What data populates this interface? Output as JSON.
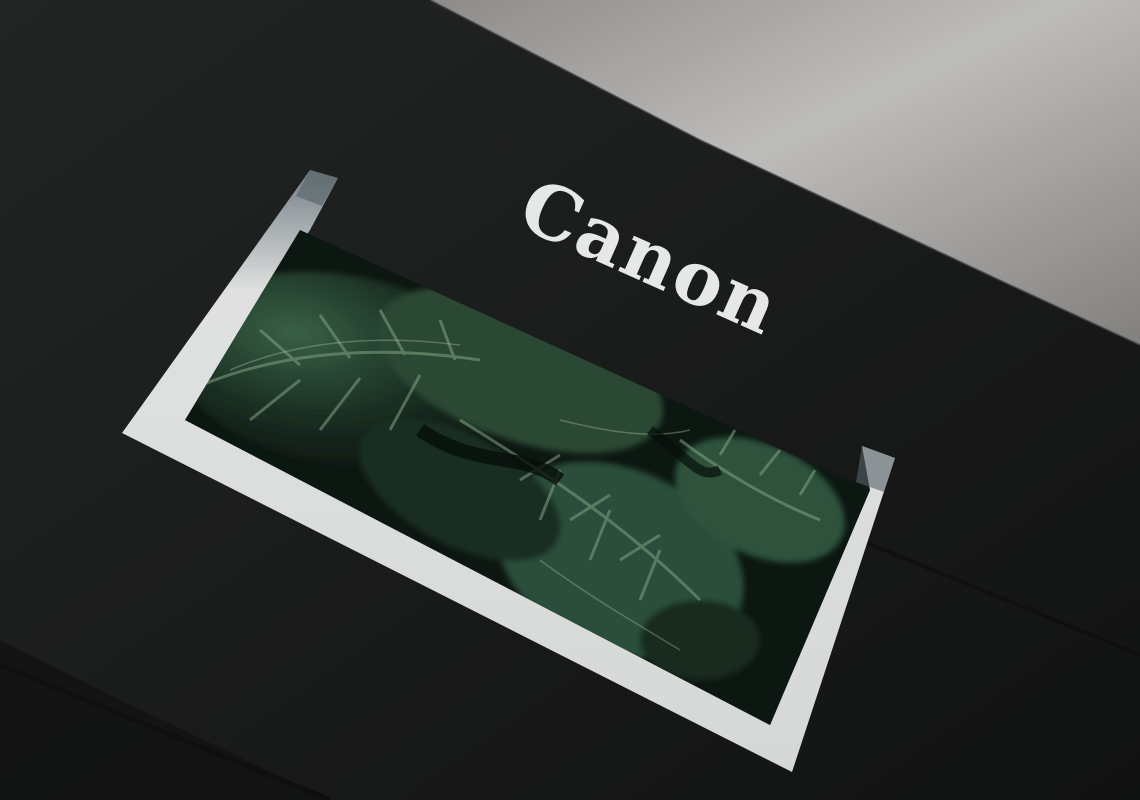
{
  "scene": {
    "description_type": "photo",
    "printer_brand": "Canon",
    "colors": {
      "printer_body": "#1c1d1d",
      "wall": "#cfcdcb",
      "paper": "#f3f4f4",
      "leaf_dark": "#14241b",
      "leaf_mid": "#3e6a4c",
      "leaf_highlight": "#b8d0b0",
      "logo": "#e6e8e8"
    }
  }
}
